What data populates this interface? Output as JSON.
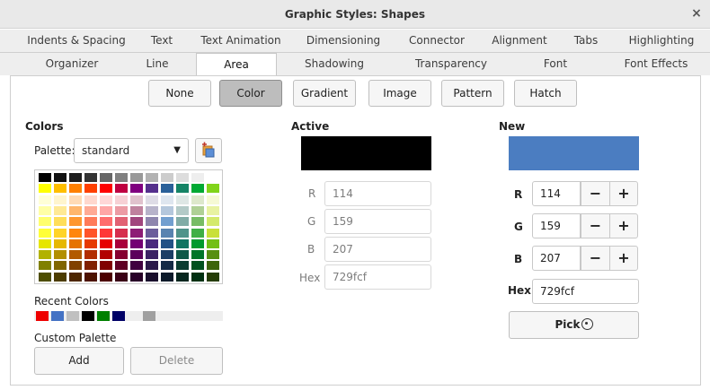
{
  "window": {
    "title": "Graphic Styles: Shapes",
    "close_glyph": "×"
  },
  "tabs_row1": [
    {
      "label": "Indents & Spacing"
    },
    {
      "label": "Text"
    },
    {
      "label": "Text Animation"
    },
    {
      "label": "Dimensioning"
    },
    {
      "label": "Connector"
    },
    {
      "label": "Alignment"
    },
    {
      "label": "Tabs"
    },
    {
      "label": "Highlighting"
    }
  ],
  "tabs_row2": [
    {
      "label": "Organizer"
    },
    {
      "label": "Line"
    },
    {
      "label": "Area"
    },
    {
      "label": "Shadowing"
    },
    {
      "label": "Transparency"
    },
    {
      "label": "Font"
    },
    {
      "label": "Font Effects"
    }
  ],
  "active_tab": "Area",
  "fill_buttons": [
    {
      "label": "None"
    },
    {
      "label": "Color"
    },
    {
      "label": "Gradient"
    },
    {
      "label": "Image"
    },
    {
      "label": "Pattern"
    },
    {
      "label": "Hatch"
    }
  ],
  "selected_fill": "Color",
  "colors": {
    "title": "Colors",
    "palette_label": "Palette:",
    "palette_value": "standard",
    "palette_icon": "add-palette-icon",
    "grid": [
      [
        "#000000",
        "#111111",
        "#1c1c1c",
        "#333333",
        "#666666",
        "#808080",
        "#999999",
        "#b2b2b2",
        "#cccccc",
        "#dddddd",
        "#eeeeee",
        "#ffffff"
      ],
      [
        "#ffff00",
        "#ffbf00",
        "#ff8000",
        "#ff4000",
        "#ff0000",
        "#bf0041",
        "#800080",
        "#55308d",
        "#2a6099",
        "#158466",
        "#00a933",
        "#81d41a"
      ],
      [
        "#ffffd7",
        "#fff5ce",
        "#ffdbb6",
        "#ffd8ce",
        "#ffd7d7",
        "#f7d1d5",
        "#e0c2cd",
        "#dedce6",
        "#dee6ef",
        "#dee7e5",
        "#dde8cb",
        "#f6f9d4"
      ],
      [
        "#ffffa6",
        "#ffe994",
        "#ffb66c",
        "#ffaa95",
        "#ffa6a6",
        "#ec9ba4",
        "#bf819e",
        "#b7b3ca",
        "#b4c7dc",
        "#b3cac7",
        "#afd095",
        "#e8f2a1"
      ],
      [
        "#ffff6d",
        "#ffde59",
        "#ff972f",
        "#ff7b59",
        "#ff6d6d",
        "#e16173",
        "#a1467e",
        "#8e86ae",
        "#729fcf",
        "#81aca6",
        "#77bc65",
        "#d4ea6b"
      ],
      [
        "#ffff38",
        "#ffd428",
        "#ff860d",
        "#ff5429",
        "#ff3838",
        "#d62e4e",
        "#8d1d75",
        "#6b5e9b",
        "#5983b0",
        "#50938a",
        "#3faf46",
        "#c9e03a"
      ],
      [
        "#e6e600",
        "#e6b800",
        "#e67300",
        "#e63900",
        "#e60000",
        "#a9003a",
        "#730073",
        "#4a2a7d",
        "#235286",
        "#127562",
        "#009a2e",
        "#72bf17"
      ],
      [
        "#b2b200",
        "#b28f00",
        "#b25900",
        "#b22c00",
        "#b20000",
        "#860030",
        "#5c005c",
        "#3b2264",
        "#1b3e66",
        "#0e5847",
        "#007528",
        "#578f11"
      ],
      [
        "#808000",
        "#806600",
        "#804000",
        "#802000",
        "#800000",
        "#600024",
        "#400040",
        "#2a1849",
        "#142a45",
        "#0b3d31",
        "#00511d",
        "#3d650b"
      ],
      [
        "#4d4d00",
        "#4d3d00",
        "#4d2600",
        "#4d1300",
        "#4d0000",
        "#3a0016",
        "#280028",
        "#1a0f2d",
        "#0c1a2a",
        "#06261e",
        "#003112",
        "#253d07"
      ]
    ],
    "recent_title": "Recent Colors",
    "recent": [
      "#ee0000",
      "#4472c4",
      "#c0c0c0",
      "#000000",
      "#008000",
      "#000066",
      "#eeeeee",
      "#a0a0a0"
    ],
    "custom_title": "Custom Palette",
    "add_label": "Add",
    "delete_label": "Delete"
  },
  "active": {
    "title": "Active",
    "swatch": "#000000",
    "r_label": "R",
    "r": "114",
    "g_label": "G",
    "g": "159",
    "b_label": "B",
    "b": "207",
    "hex_label": "Hex",
    "hex": "729fcf"
  },
  "new": {
    "title": "New",
    "swatch": "#4b7dc1",
    "r_label": "R",
    "r": "114",
    "g_label": "G",
    "g": "159",
    "b_label": "B",
    "b": "207",
    "hex_label": "Hex",
    "hex": "729fcf",
    "minus": "−",
    "plus": "+",
    "pick_label": "Pick",
    "pick_icon": "color-picker-icon"
  }
}
